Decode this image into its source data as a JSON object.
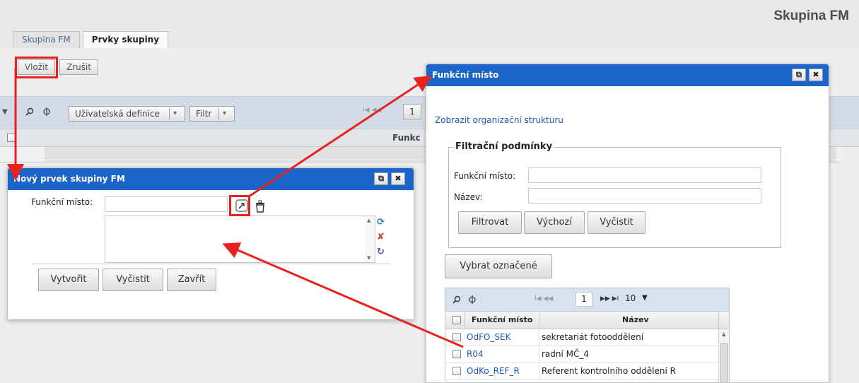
{
  "app": {
    "title": "Skupina FM"
  },
  "tabs": [
    {
      "label": "Skupina FM",
      "active": false
    },
    {
      "label": "Prvky skupiny",
      "active": true
    }
  ],
  "actions": {
    "insert_label": "Vložit",
    "cancel_label": "Zrušit"
  },
  "grid": {
    "user_definition_label": "Uživatelská definice",
    "filter_label": "Filtr",
    "page_value": "1",
    "column_header": "Funkc"
  },
  "new_item_dialog": {
    "title": "Nový prvek skupiny FM",
    "field_label": "Funkční místo:",
    "create_label": "Vytvořit",
    "clear_label": "Vyčistit",
    "close_label": "Zavřít"
  },
  "picker_dialog": {
    "title": "Funkční místo",
    "org_link": "Zobrazit organizační strukturu",
    "filter_legend": "Filtrační podmínky",
    "filter_fields": [
      {
        "label": "Funkční místo:",
        "value": ""
      },
      {
        "label": "Název:",
        "value": ""
      }
    ],
    "filter_button": "Filtrovat",
    "default_button": "Výchozí",
    "clear_button": "Vyčistit",
    "select_marked_button": "Vybrat označené",
    "pager": {
      "page": "1",
      "page_size": "10"
    },
    "columns": [
      "Funkční místo",
      "Název"
    ],
    "rows": [
      {
        "code": "OdFO_SEK",
        "name": "sekretariát fotooddělení"
      },
      {
        "code": "R04",
        "name": "radní MČ_4"
      },
      {
        "code": "OdKo_REF_R",
        "name": "Referent kontrolního oddělení R"
      }
    ]
  },
  "colors": {
    "title_bar": "#1b64c9",
    "annotation": "#e8231f",
    "link": "#1e5aa8"
  }
}
